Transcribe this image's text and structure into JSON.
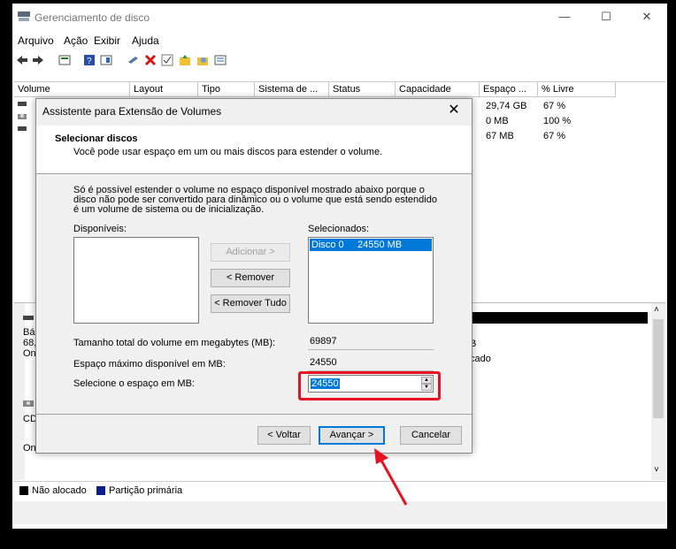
{
  "window": {
    "title": "Gerenciamento de disco",
    "caption": {
      "minimize": "—",
      "maximize": "☐",
      "close": "✕"
    }
  },
  "menu": [
    "Arquivo",
    "Ação",
    "Exibir",
    "Ajuda"
  ],
  "toolbar_icons": [
    "back-icon",
    "forward-icon",
    "disk-list-icon",
    "help-icon",
    "properties-icon",
    "connect-icon",
    "delete-icon",
    "check-icon",
    "folder-up-icon",
    "search-icon",
    "list-icon"
  ],
  "volume_table": {
    "columns": [
      "Volume",
      "Layout",
      "Tipo",
      "Sistema de ...",
      "Status",
      "Capacidade",
      "Espaço ...",
      "% Livre"
    ],
    "rows": [
      {
        "espaco": "29,74 GB",
        "livre": "67 %"
      },
      {
        "espaco": "0 MB",
        "livre": "100 %"
      },
      {
        "espaco": "67 MB",
        "livre": "67 %"
      }
    ]
  },
  "disk_view": {
    "disk0": {
      "name_fragment": "Bá",
      "size_fragment": "68,",
      "status_fragment": "On",
      "right_fragment1": "B",
      "right_fragment2": "cado"
    },
    "cdrom": {
      "name_fragment": "CD",
      "status_fragment": "On"
    }
  },
  "legend": [
    {
      "label": "Não alocado",
      "color": "#000000"
    },
    {
      "label": "Partição primária",
      "color": "#0a1e8c"
    }
  ],
  "dialog": {
    "title": "Assistente para Extensão de Volumes",
    "heading": "Selecionar discos",
    "subheading": "Você pode usar espaço em um ou mais discos para estender o volume.",
    "description": "Só é possível estender o volume no espaço disponível mostrado abaixo porque o disco não pode ser convertido para dinâmico ou o volume que está sendo estendido é um volume de sistema ou de inicialização.",
    "available_label": "Disponíveis:",
    "selected_label": "Selecionados:",
    "selected_items": [
      {
        "disk": "Disco 0",
        "size": "24550 MB"
      }
    ],
    "buttons": {
      "add": "Adicionar >",
      "remove": "< Remover",
      "remove_all": "< Remover Tudo",
      "back": "< Voltar",
      "next": "Avançar >",
      "cancel": "Cancelar"
    },
    "total_label": "Tamanho total do volume em megabytes (MB):",
    "total_value": "69897",
    "max_label": "Espaço máximo disponível em MB:",
    "max_value": "24550",
    "select_label": "Selecione o espaço em MB:",
    "select_value": "24550"
  },
  "annotation": {
    "highlight_color": "#e81123",
    "arrow_color": "#e81123"
  }
}
